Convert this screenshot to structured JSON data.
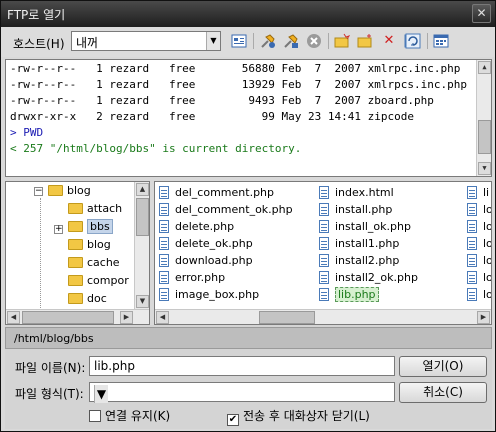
{
  "window": {
    "title": "FTP로 열기",
    "close_glyph": "✕"
  },
  "toolbar": {
    "host_label": "호스트(H)",
    "host_value": "내꺼",
    "icons": [
      "bookmark-manager-icon",
      "connect-icon",
      "disconnect-icon",
      "stop-icon",
      "new-folder-icon",
      "open-folder-icon",
      "delete-icon",
      "rename-icon",
      "refresh-icon",
      "view-mode-icon"
    ]
  },
  "log": {
    "lines": [
      {
        "text": "-rw-r--r--   1 rezard   free       56880 Feb  7  2007 xmlrpc.inc.php",
        "kind": "data"
      },
      {
        "text": "-rw-r--r--   1 rezard   free       13929 Feb  7  2007 xmlrpcs.inc.php",
        "kind": "data"
      },
      {
        "text": "-rw-r--r--   1 rezard   free        9493 Feb  7  2007 zboard.php",
        "kind": "data"
      },
      {
        "text": "drwxr-xr-x   2 rezard   free          99 May 23 14:41 zipcode",
        "kind": "data"
      },
      {
        "text": "> PWD",
        "kind": "cmd"
      },
      {
        "text": "< 257 \"/html/blog/bbs\" is current directory.",
        "kind": "resp"
      }
    ]
  },
  "tree": {
    "items": [
      {
        "label": "blog",
        "level": 0,
        "expander": "−"
      },
      {
        "label": "attach",
        "level": 1,
        "expander": ""
      },
      {
        "label": "bbs",
        "level": 1,
        "expander": "+",
        "selected": true
      },
      {
        "label": "blog",
        "level": 1,
        "expander": ""
      },
      {
        "label": "cache",
        "level": 1,
        "expander": ""
      },
      {
        "label": "compor",
        "level": 1,
        "expander": ""
      },
      {
        "label": "doc",
        "level": 1,
        "expander": ""
      }
    ]
  },
  "files": {
    "col1": [
      "del_comment.php",
      "del_comment_ok.php",
      "delete.php",
      "delete_ok.php",
      "download.php",
      "error.php",
      "image_box.php"
    ],
    "col2": [
      "index.html",
      "install.php",
      "install_ok.php",
      "install1.php",
      "install2.php",
      "install2_ok.php",
      "lib.php"
    ],
    "col3": [
      "li",
      "lo",
      "lo",
      "lo",
      "lo",
      "lo",
      "lo"
    ],
    "selected": "lib.php"
  },
  "bottom": {
    "current_path": "/html/blog/bbs",
    "filename_label": "파일 이름(N):",
    "filename_value": "lib.php",
    "filetype_label": "파일 형식(T):",
    "filetype_value": "",
    "open_button": "열기(O)",
    "cancel_button": "취소(C)",
    "keep_connection": "연결 유지(K)",
    "keep_connection_checked": false,
    "close_after": "전송 후 대화상자 닫기(L)",
    "close_after_checked": true
  }
}
